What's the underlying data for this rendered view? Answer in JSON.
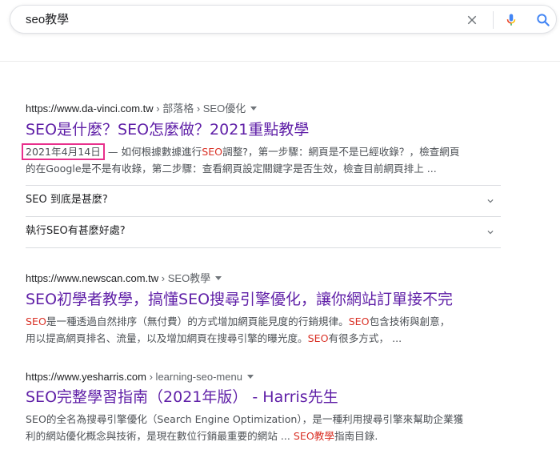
{
  "search": {
    "query": "seo教學"
  },
  "results": [
    {
      "url": "https://www.da-vinci.com.tw",
      "breadcrumb": " › 部落格 › SEO優化",
      "title": "SEO是什麼？SEO怎麼做？2021重點教學",
      "date": "2021年4月14日",
      "snippet_line1_a": " — 如何根據數據進行",
      "snippet_line1_hl": "SEO",
      "snippet_line1_b": "調整?，第一步驟：網頁是不是已經收錄？，檢查網頁",
      "snippet_line2": "的在Google是不是有收錄，第二步驟：查看網頁設定關鍵字是否生效，檢查目前網頁排上 ...",
      "faq": [
        "SEO 到底是甚麼?",
        "執行SEO有甚麼好處?"
      ]
    },
    {
      "url": "https://www.newscan.com.tw",
      "breadcrumb": " › SEO教學",
      "title": "SEO初學者教學，搞懂SEO搜尋引擎優化，讓你網站訂單接不完",
      "snippet_hl1": "SEO",
      "snippet_a": "是一種透過自然排序（無付費）的方式增加網頁能見度的行銷規律。",
      "snippet_hl2": "SEO",
      "snippet_b": "包含技術與創意，",
      "snippet_line2_a": "用以提高網頁排名、流量，以及增加網頁在搜尋引擎的曝光度。",
      "snippet_hl3": "SEO",
      "snippet_line2_b": "有很多方式， ..."
    },
    {
      "url": "https://www.yesharris.com",
      "breadcrumb": " › learning-seo-menu",
      "title": "SEO完整學習指南（2021年版） - Harris先生",
      "snippet_line1": "SEO的全名為搜尋引擎優化（Search Engine Optimization），是一種利用搜尋引擎來幫助企業獲",
      "snippet_line2_a": "利的網站優化概念與技術，是現在數位行銷最重要的網站 ... ",
      "snippet_hl": "SEO教學",
      "snippet_line2_b": "指南目錄."
    }
  ],
  "colors": {
    "title": "#5f1fa7",
    "highlight": "#d93025",
    "date_box": "#e8308c",
    "snippet": "#4d5156"
  }
}
